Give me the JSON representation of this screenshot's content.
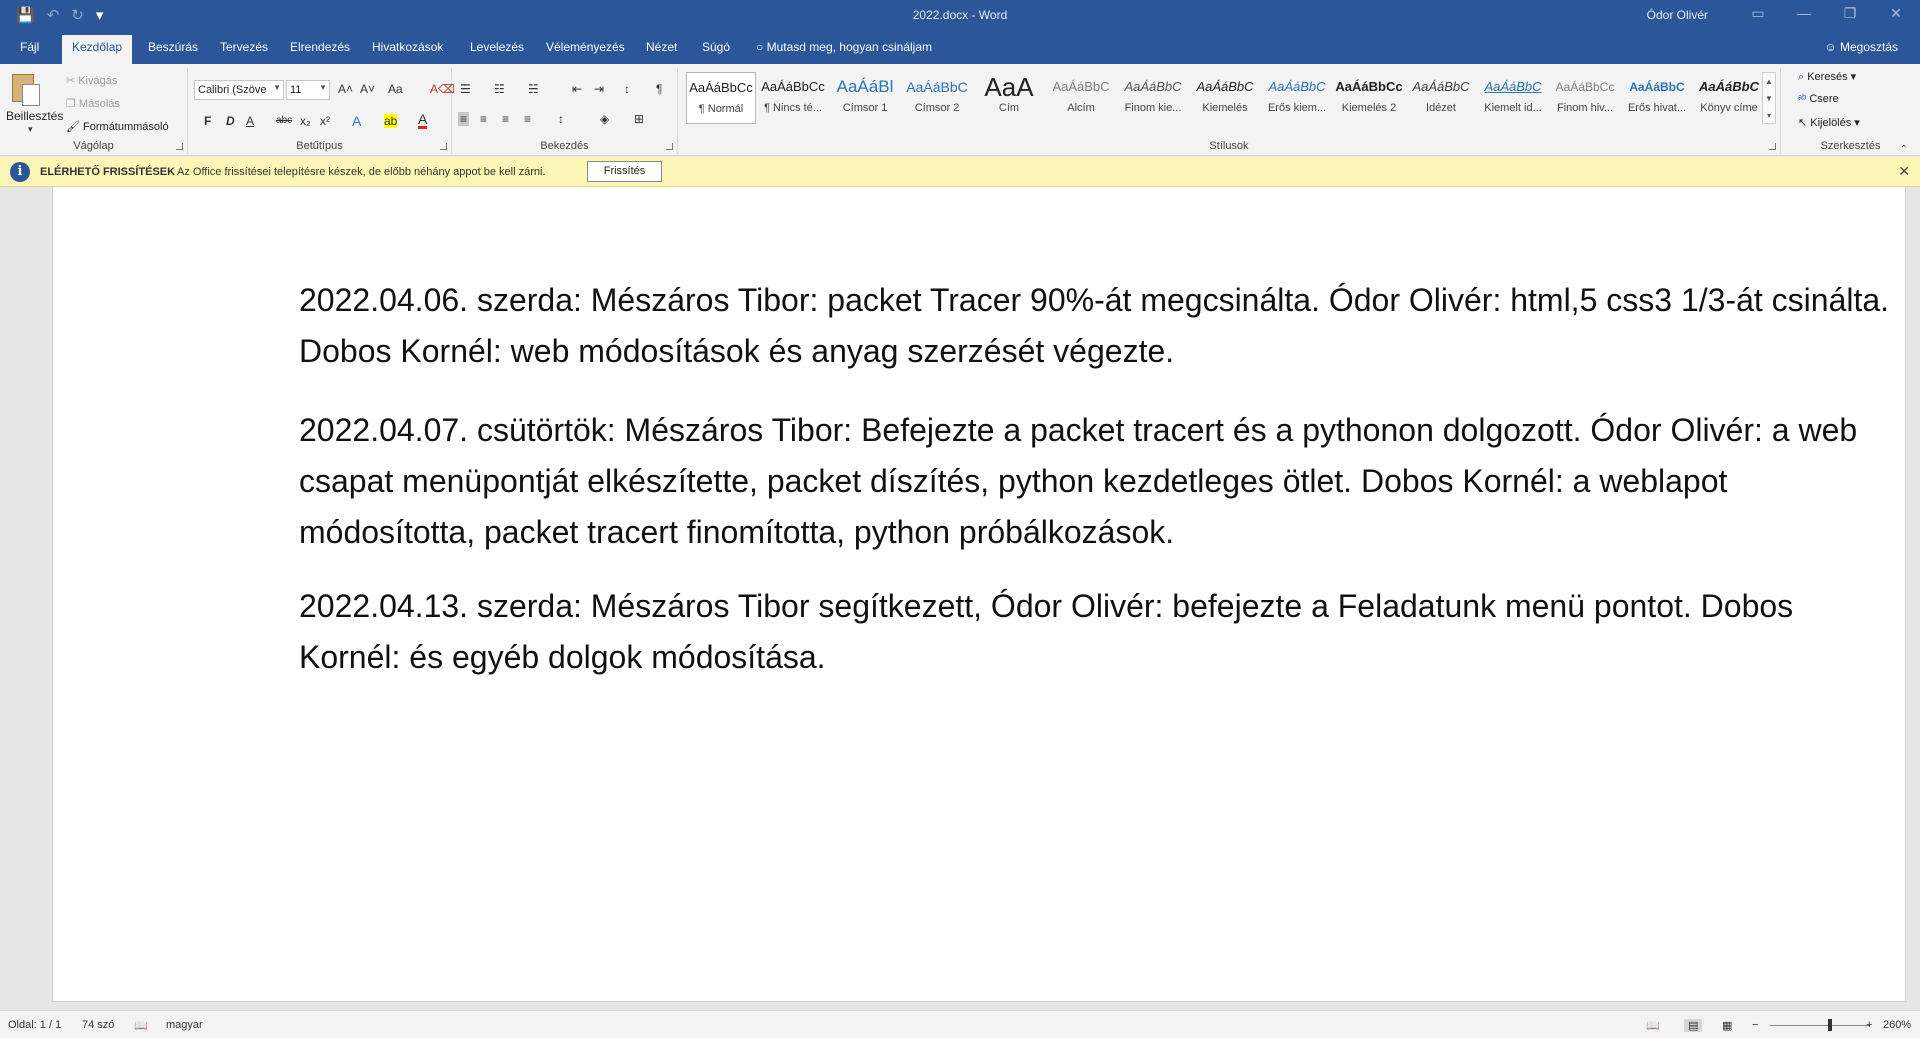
{
  "titlebar": {
    "title": "2022.docx  -  Word",
    "user": "Ódor Olivér",
    "qat": {
      "save_icon": "💾",
      "undo_icon": "↶",
      "redo_icon": "↻",
      "customize_icon": "▾"
    },
    "controls": {
      "ribbon_display": "▭",
      "minimize": "—",
      "restore": "❐",
      "close": "✕"
    }
  },
  "tabs": [
    {
      "label": "Fájl"
    },
    {
      "label": "Kezdőlap"
    },
    {
      "label": "Beszúrás"
    },
    {
      "label": "Tervezés"
    },
    {
      "label": "Elrendezés"
    },
    {
      "label": "Hivatkozások"
    },
    {
      "label": "Levelezés"
    },
    {
      "label": "Véleményezés"
    },
    {
      "label": "Nézet"
    },
    {
      "label": "Súgó"
    }
  ],
  "tell_me": "Mutasd meg, hogyan csináljam",
  "share": "Megosztás",
  "ribbon": {
    "clipboard": {
      "label": "Vágólap",
      "paste": "Beillesztés",
      "cut": "Kivágás",
      "copy": "Másolás",
      "format_painter": "Formátummásoló"
    },
    "font": {
      "label": "Betűtípus",
      "font_name": "Calibri (Szöve",
      "font_size": "11",
      "grow": "A˄",
      "shrink": "A˅",
      "case": "Aa",
      "clear": "A⌫",
      "bold": "F",
      "italic": "D",
      "underline": "A",
      "strike": "abc",
      "subscript": "x₂",
      "superscript": "x²",
      "effects": "A",
      "highlight": "ab",
      "color": "A"
    },
    "paragraph": {
      "label": "Bekezdés",
      "bullets": "☰",
      "numbering": "☷",
      "multilevel": "☵",
      "decrease_indent": "⇤",
      "increase_indent": "⇥",
      "sort": "↕",
      "show_marks": "¶",
      "align_left": "≡",
      "align_center": "≡",
      "align_right": "≡",
      "justify": "≡",
      "line_spacing": "↕",
      "shading": "◈",
      "borders": "⊞"
    },
    "styles": {
      "label": "Stílusok",
      "items": [
        {
          "sample": "AaÁáBbCc",
          "name": "¶ Normál"
        },
        {
          "sample": "AaÁáBbCc",
          "name": "¶ Nincs té..."
        },
        {
          "sample": "AaÁáBl",
          "name": "Címsor 1"
        },
        {
          "sample": "AaÁáBbC",
          "name": "Címsor 2"
        },
        {
          "sample": "AaA",
          "name": "Cím"
        },
        {
          "sample": "AaÁáBbC",
          "name": "Alcím"
        },
        {
          "sample": "AaÁáBbC",
          "name": "Finom kie..."
        },
        {
          "sample": "AaÁáBbC",
          "name": "Kiemelés"
        },
        {
          "sample": "AaÁáBbC",
          "name": "Erős kiem..."
        },
        {
          "sample": "AaÁáBbCc",
          "name": "Kiemelés 2"
        },
        {
          "sample": "AaÁáBbC",
          "name": "Idézet"
        },
        {
          "sample": "AaÁáBbC",
          "name": "Kiemelt id..."
        },
        {
          "sample": "AaÁáBbCc",
          "name": "Finom hiv..."
        },
        {
          "sample": "AaÁáBbC",
          "name": "Erős hivat..."
        },
        {
          "sample": "AaÁáBbC",
          "name": "Könyv címe"
        }
      ],
      "colors": {
        "heading": "#2e74b5",
        "subtle": "#7f7f7f",
        "emphasis_blue": "#2e74b5"
      }
    },
    "editing": {
      "label": "Szerkesztés",
      "find": "Keresés",
      "replace": "Csere",
      "select": "Kijelölés"
    }
  },
  "message_bar": {
    "title": "ELÉRHETŐ FRISSÍTÉSEK",
    "text": "Az Office frissítései telepítésre készek, de előbb néhány appot be kell zárni.",
    "button": "Frissítés",
    "close": "✕"
  },
  "document": {
    "paragraphs": [
      "2022.04.06. szerda: Mészáros Tibor: packet Tracer 90%-át megcsinálta. Ódor Olivér: html,5 css3 1/3-át csinálta. Dobos Kornél: web módosítások és anyag szerzését végezte.",
      "2022.04.07. csütörtök: Mészáros Tibor: Befejezte a packet tracert és a pythonon dolgozott. Ódor Olivér: a web csapat menüpontját elkészítette, packet díszítés, python kezdetleges ötlet. Dobos Kornél: a weblapot módosította, packet tracert finomította, python próbálkozások.",
      "2022.04.13. szerda: Mészáros Tibor segítkezett, Ódor Olivér: befejezte a Feladatunk menü pontot. Dobos Kornél: és egyéb dolgok módosítása."
    ]
  },
  "statusbar": {
    "page": "Oldal: 1 / 1",
    "words": "74 szó",
    "language": "magyar",
    "zoom_out": "−",
    "zoom_in": "+",
    "zoom": "260%",
    "zoom_fraction": 0.6
  },
  "colors": {
    "accent": "#2b579a",
    "ribbon_bg": "#f3f3f3",
    "message_bg": "#fcf7b6"
  }
}
